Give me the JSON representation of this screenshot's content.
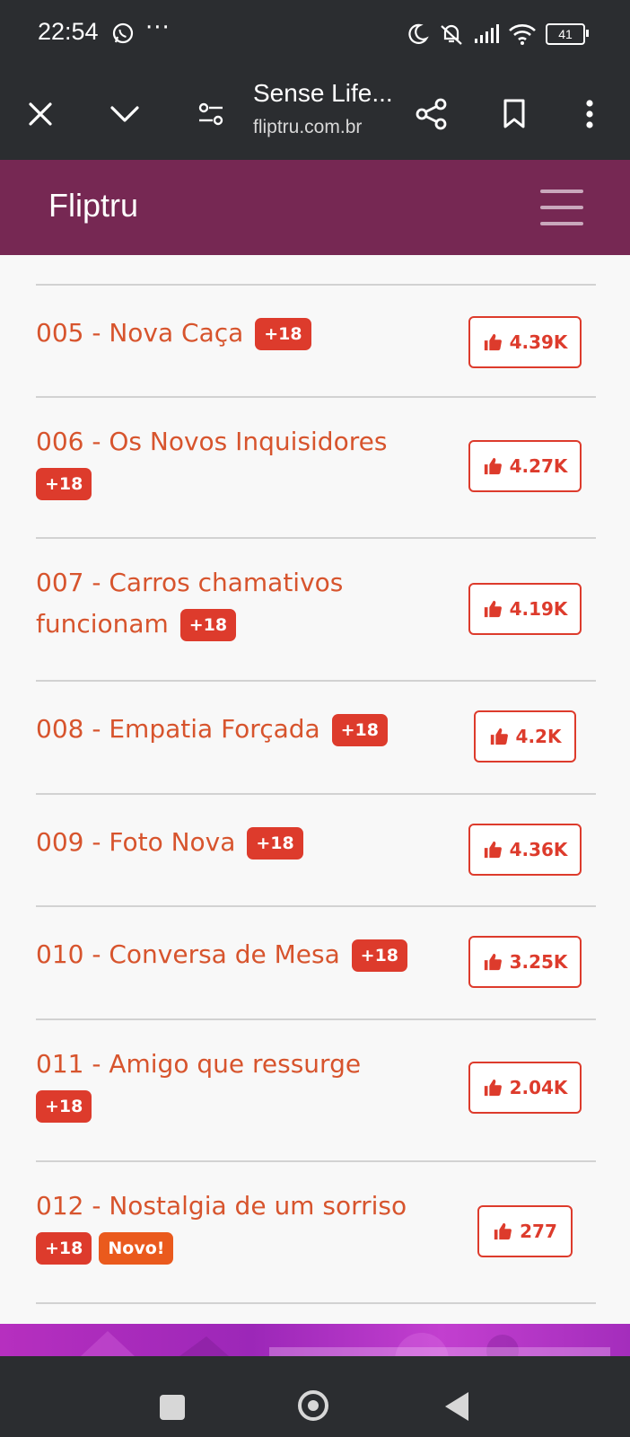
{
  "status_bar": {
    "time": "22:54",
    "more": "···",
    "battery": "41"
  },
  "browser": {
    "page_title": "Sense Life...",
    "url": "fliptru.com.br"
  },
  "site": {
    "brand": "Fliptru"
  },
  "chapters": [
    {
      "title": "005 - Nova Caça",
      "badge": "+18",
      "likes": "4.39K"
    },
    {
      "title": "006 - Os Novos Inquisidores",
      "badge": "+18",
      "likes": "4.27K"
    },
    {
      "title": "007 - Carros chamativos funcionam",
      "badge": "+18",
      "likes": "4.19K"
    },
    {
      "title": "008 - Empatia Forçada",
      "badge": "+18",
      "likes": "4.2K"
    },
    {
      "title": "009 - Foto Nova",
      "badge": "+18",
      "likes": "4.36K"
    },
    {
      "title": "010 - Conversa de Mesa",
      "badge": "+18",
      "likes": "3.25K"
    },
    {
      "title": "011 - Amigo que ressurge",
      "badge": "+18",
      "likes": "2.04K"
    },
    {
      "title": "012 - Nostalgia de um sorriso",
      "badge": "+18",
      "new_badge": "Novo!",
      "likes": "277"
    }
  ],
  "colors": {
    "header": "#762853",
    "link": "#d7542d",
    "badge": "#dd3b2c",
    "new_badge": "#ea5a1d",
    "system_bar": "#2b2d30"
  }
}
